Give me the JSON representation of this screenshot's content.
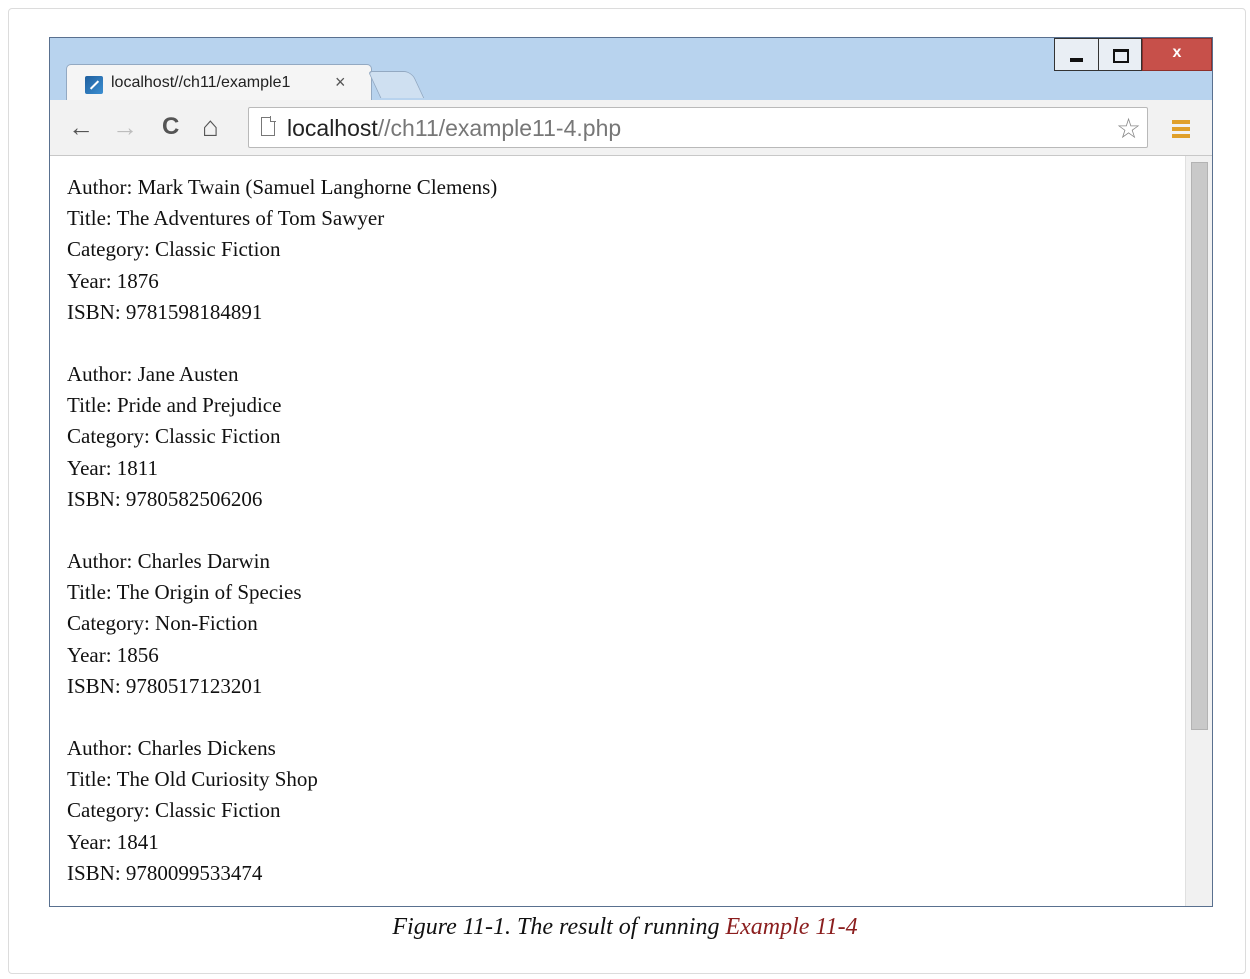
{
  "browser": {
    "tab": {
      "title": "localhost//ch11/example1",
      "close_glyph": "×",
      "favicon": "zend-icon"
    },
    "window_controls": {
      "minimize": "minimize-icon",
      "maximize": "maximize-icon",
      "close_label": "x"
    },
    "toolbar": {
      "back": "←",
      "forward": "→",
      "reload": "C",
      "home": "⌂",
      "url_host": "localhost",
      "url_path": "//ch11/example11-4.php",
      "star": "☆"
    },
    "accent": "#e0a02a"
  },
  "books": [
    {
      "author": "Author: Mark Twain (Samuel Langhorne Clemens)",
      "title": "Title: The Adventures of Tom Sawyer",
      "category": "Category: Classic Fiction",
      "year": "Year: 1876",
      "isbn": "ISBN: 9781598184891"
    },
    {
      "author": "Author: Jane Austen",
      "title": "Title: Pride and Prejudice",
      "category": "Category: Classic Fiction",
      "year": "Year: 1811",
      "isbn": "ISBN: 9780582506206"
    },
    {
      "author": "Author: Charles Darwin",
      "title": "Title: The Origin of Species",
      "category": "Category: Non-Fiction",
      "year": "Year: 1856",
      "isbn": "ISBN: 9780517123201"
    },
    {
      "author": "Author: Charles Dickens",
      "title": "Title: The Old Curiosity Shop",
      "category": "Category: Classic Fiction",
      "year": "Year: 1841",
      "isbn": "ISBN: 9780099533474"
    }
  ],
  "caption": {
    "prefix": "Figure 11-1. The result of running ",
    "link": "Example 11-4"
  }
}
